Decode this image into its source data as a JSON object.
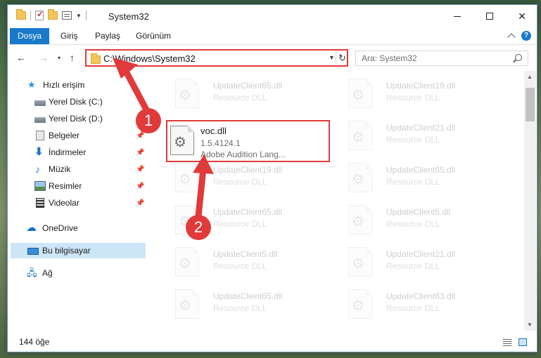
{
  "window": {
    "title": "System32"
  },
  "ribbon": {
    "tabs": [
      "Dosya",
      "Giriş",
      "Paylaş",
      "Görünüm"
    ]
  },
  "address": {
    "path": "C:\\Windows\\System32"
  },
  "search": {
    "placeholder": "Ara: System32"
  },
  "nav": {
    "items": [
      {
        "label": "Hızlı erişim",
        "icon": "star-icon"
      },
      {
        "label": "Yerel Disk (C:)",
        "icon": "drive-icon"
      },
      {
        "label": "Yerel Disk (D:)",
        "icon": "drive-icon"
      },
      {
        "label": "Belgeler",
        "icon": "documents-icon"
      },
      {
        "label": "İndirmeler",
        "icon": "download-icon"
      },
      {
        "label": "Müzik",
        "icon": "music-icon"
      },
      {
        "label": "Resimler",
        "icon": "pictures-icon"
      },
      {
        "label": "Videolar",
        "icon": "video-icon"
      },
      {
        "label": "OneDrive",
        "icon": "cloud-icon"
      },
      {
        "label": "Bu bilgisayar",
        "icon": "computer-icon"
      },
      {
        "label": "Ağ",
        "icon": "network-icon"
      }
    ]
  },
  "files": [
    {
      "name": "UpdateClient65.dll",
      "type": "Resource DLL"
    },
    {
      "name": "UpdateClient19.dll",
      "type": "Resource DLL"
    },
    {
      "name": "UpdateClient21.dll",
      "type": "Resource DLL"
    },
    {
      "name": "UpdateClient19.dll",
      "type": "Resource DLL"
    },
    {
      "name": "UpdateClient65.dll",
      "type": "Resource DLL"
    },
    {
      "name": "UpdateClient65.dll",
      "type": "Resource DLL"
    },
    {
      "name": "UpdateClient5.dll",
      "type": "Resource DLL"
    },
    {
      "name": "UpdateClient5.dll",
      "type": "Resource DLL"
    },
    {
      "name": "UpdateClient21.dll",
      "type": "Resource DLL"
    },
    {
      "name": "UpdateClient65.dll",
      "type": "Resource DLL"
    },
    {
      "name": "UpdateClient63.dll",
      "type": "Resource DLL"
    }
  ],
  "highlighted_file": {
    "name": "voc.dll",
    "version": "1.5.4124.1",
    "description": "Adobe Audition Lang..."
  },
  "status": {
    "count": "144 öğe"
  },
  "annotations": {
    "step1": "1",
    "step2": "2"
  },
  "colors": {
    "accent": "#1979ca",
    "annotation": "#e03a3a"
  }
}
